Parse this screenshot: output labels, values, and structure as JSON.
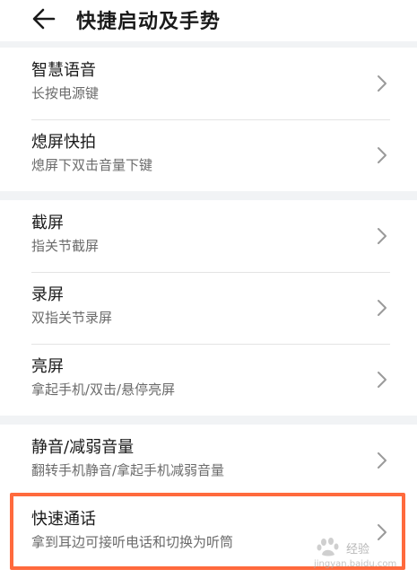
{
  "header": {
    "title": "快捷启动及手势",
    "back_icon": "arrow-left-icon"
  },
  "groups": [
    {
      "items": [
        {
          "title": "智慧语音",
          "subtitle": "长按电源键"
        },
        {
          "title": "熄屏快拍",
          "subtitle": "熄屏下双击音量下键"
        }
      ]
    },
    {
      "items": [
        {
          "title": "截屏",
          "subtitle": "指关节截屏"
        },
        {
          "title": "录屏",
          "subtitle": "双指关节录屏"
        },
        {
          "title": "亮屏",
          "subtitle": "拿起手机/双击/悬停亮屏"
        }
      ]
    },
    {
      "items": [
        {
          "title": "静音/减弱音量",
          "subtitle": "翻转手机静音/拿起手机减弱音量"
        },
        {
          "title": "快速通话",
          "subtitle": "拿到耳边可接听电话和切换为听筒"
        }
      ]
    }
  ],
  "chevron_icon": "chevron-right-icon",
  "colors": {
    "highlight": "#ff6a3d",
    "background": "#f1f3f5",
    "card": "#ffffff"
  },
  "watermark": {
    "brand": "经验",
    "url": "jingyan.baidu.com"
  }
}
